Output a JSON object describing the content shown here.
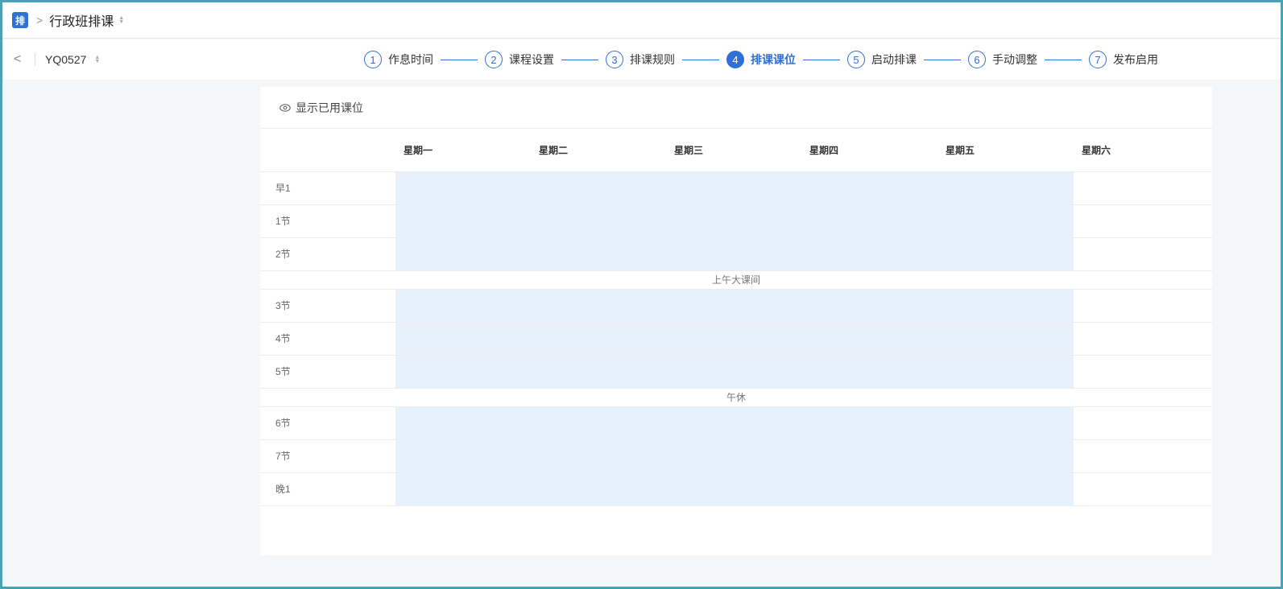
{
  "header": {
    "badge": "排",
    "separator": ">",
    "title": "行政班排课"
  },
  "plan": {
    "back": "<",
    "name": "YQ0527"
  },
  "steps": [
    {
      "num": "1",
      "label": "作息时间"
    },
    {
      "num": "2",
      "label": "课程设置"
    },
    {
      "num": "3",
      "label": "排课规则"
    },
    {
      "num": "4",
      "label": "排课课位",
      "active": true
    },
    {
      "num": "5",
      "label": "启动排课"
    },
    {
      "num": "6",
      "label": "手动调整"
    },
    {
      "num": "7",
      "label": "发布启用"
    }
  ],
  "toolbar": {
    "show_used_label": "显示已用课位"
  },
  "timetable": {
    "days": [
      "星期一",
      "星期二",
      "星期三",
      "星期四",
      "星期五",
      "星期六"
    ],
    "rows": [
      {
        "label": "早1"
      },
      {
        "label": "1节"
      },
      {
        "label": "2节"
      },
      {
        "break": "上午大课间"
      },
      {
        "label": "3节"
      },
      {
        "label": "4节"
      },
      {
        "label": "5节"
      },
      {
        "break": "午休"
      },
      {
        "label": "6节"
      },
      {
        "label": "7节"
      },
      {
        "label": "晚1"
      }
    ]
  },
  "colors": {
    "accent": "#2f6fd6",
    "slot_available": "#e6f1fc",
    "frame_border": "#4aa3b5"
  }
}
